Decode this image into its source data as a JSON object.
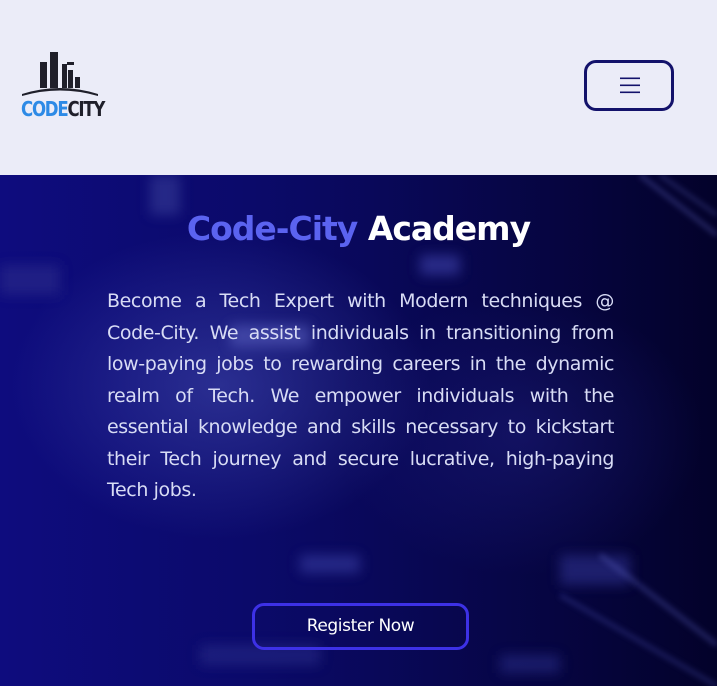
{
  "header": {
    "logo": {
      "text_part1": "CODE",
      "text_part2": "CITY",
      "icon": "city-skyline-icon",
      "color_part1": "#2d8ae6",
      "color_part2": "#1f1f2a"
    },
    "menu_button": {
      "icon": "hamburger-menu-icon",
      "border_color": "#13126b"
    },
    "background": "#ebecf8"
  },
  "hero": {
    "title_part1": "Code-City",
    "title_part2": "Academy",
    "title_accent_color": "#5b63f0",
    "description": "Become a Tech Expert with Modern techniques @ Code-City. We assist individuals in transitioning from low-paying jobs to rewarding careers in the dynamic realm of Tech. We empower individuals with the essential knowledge and skills necessary to kickstart their Tech journey and secure lucrative, high-paying Tech jobs.",
    "register_button_label": "Register Now",
    "register_button_border": "#3d31e6",
    "background_color": "#0b0a6a"
  }
}
